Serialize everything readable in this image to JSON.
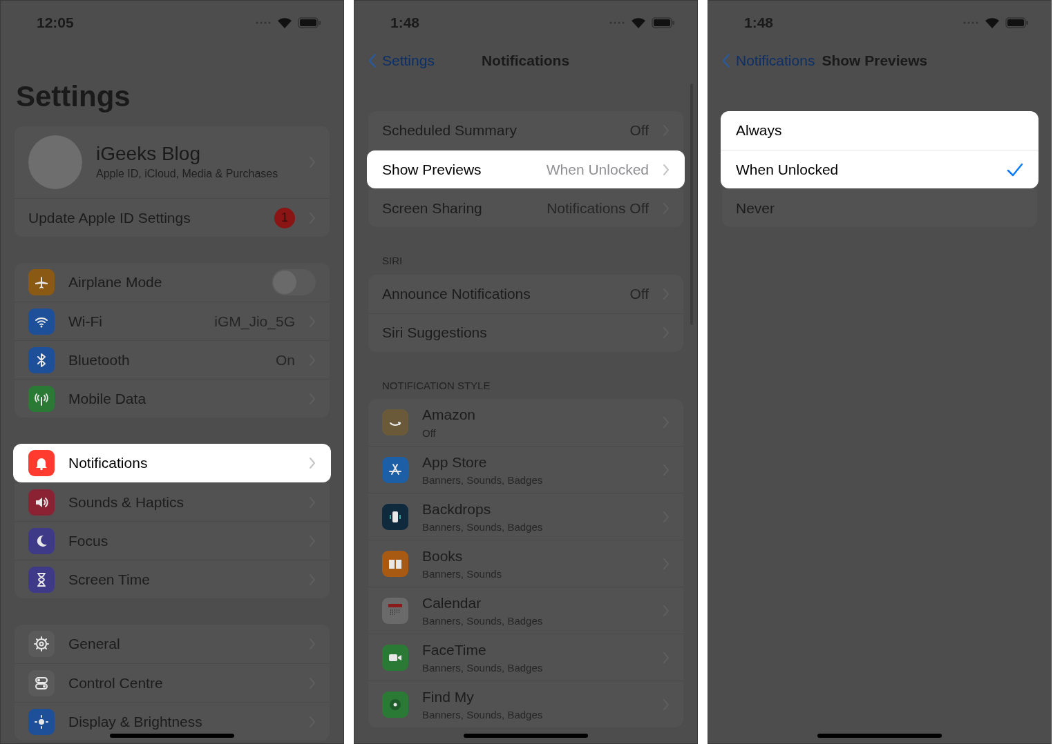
{
  "screens": [
    {
      "status_time": "12:05",
      "large_title": "Settings",
      "groups": [
        {
          "rows": [
            {
              "kind": "profile",
              "label": "iGeeks Blog",
              "subtitle": "Apple ID, iCloud, Media & Purchases",
              "highlighted": false
            },
            {
              "kind": "link",
              "label": "Update Apple ID Settings",
              "badge": "1",
              "highlighted": false
            }
          ]
        },
        {
          "rows": [
            {
              "kind": "toggle",
              "label": "Airplane Mode",
              "on": false,
              "color": "#8a5a14",
              "highlighted": false
            },
            {
              "kind": "link",
              "label": "Wi-Fi",
              "value": "iGM_Jio_5G",
              "color": "#1e4f99",
              "highlighted": false
            },
            {
              "kind": "link",
              "label": "Bluetooth",
              "value": "On",
              "color": "#1e4f99",
              "highlighted": false
            },
            {
              "kind": "link",
              "label": "Mobile Data",
              "color": "#2a7a35",
              "highlighted": false
            }
          ]
        },
        {
          "rows": [
            {
              "kind": "link",
              "label": "Notifications",
              "color": "#ff3b30",
              "highlighted": true
            },
            {
              "kind": "link",
              "label": "Sounds & Haptics",
              "color": "#8a2233",
              "highlighted": false
            },
            {
              "kind": "link",
              "label": "Focus",
              "color": "#3f3a88",
              "highlighted": false
            },
            {
              "kind": "link",
              "label": "Screen Time",
              "color": "#3f3a88",
              "highlighted": false
            }
          ]
        },
        {
          "rows": [
            {
              "kind": "link",
              "label": "General",
              "color": "#5a5a5a",
              "highlighted": false
            },
            {
              "kind": "link",
              "label": "Control Centre",
              "color": "#5a5a5a",
              "highlighted": false
            },
            {
              "kind": "link",
              "label": "Display & Brightness",
              "color": "#1e4f99",
              "highlighted": false
            }
          ]
        }
      ]
    },
    {
      "status_time": "1:48",
      "nav": {
        "back": "Settings",
        "title": "Notifications"
      },
      "groups": [
        {
          "rows": [
            {
              "kind": "link",
              "label": "Scheduled Summary",
              "value": "Off",
              "highlighted": false
            },
            {
              "kind": "link",
              "label": "Show Previews",
              "value": "When Unlocked",
              "highlighted": true
            },
            {
              "kind": "link",
              "label": "Screen Sharing",
              "value": "Notifications Off",
              "highlighted": false
            }
          ]
        },
        {
          "header": "SIRI",
          "rows": [
            {
              "kind": "link",
              "label": "Announce Notifications",
              "value": "Off",
              "highlighted": false
            },
            {
              "kind": "link",
              "label": "Siri Suggestions",
              "highlighted": false
            }
          ]
        },
        {
          "header": "NOTIFICATION STYLE",
          "rows": [
            {
              "kind": "app",
              "label": "Amazon",
              "subtitle": "Off",
              "color": "#6b5a3a",
              "highlighted": false
            },
            {
              "kind": "app",
              "label": "App Store",
              "subtitle": "Banners, Sounds, Badges",
              "color": "#1d5fa6",
              "highlighted": false
            },
            {
              "kind": "app",
              "label": "Backdrops",
              "subtitle": "Banners, Sounds, Badges",
              "color": "#0f2a3d",
              "highlighted": false
            },
            {
              "kind": "app",
              "label": "Books",
              "subtitle": "Banners, Sounds",
              "color": "#a85a12",
              "highlighted": false
            },
            {
              "kind": "app",
              "label": "Calendar",
              "subtitle": "Banners, Sounds, Badges",
              "color": "#6a6a6a",
              "highlighted": false
            },
            {
              "kind": "app",
              "label": "FaceTime",
              "subtitle": "Banners, Sounds, Badges",
              "color": "#2a7a35",
              "highlighted": false
            },
            {
              "kind": "app",
              "label": "Find My",
              "subtitle": "Banners, Sounds, Badges",
              "color": "#2a7a35",
              "highlighted": false
            }
          ]
        }
      ]
    },
    {
      "status_time": "1:48",
      "nav": {
        "back": "Notifications",
        "title": "Show Previews"
      },
      "groups": [
        {
          "rows": [
            {
              "kind": "option",
              "label": "Always",
              "selected": false,
              "highlighted": true
            },
            {
              "kind": "option",
              "label": "When Unlocked",
              "selected": true,
              "highlighted": true
            },
            {
              "kind": "option",
              "label": "Never",
              "selected": false,
              "highlighted": false
            }
          ]
        }
      ]
    }
  ]
}
